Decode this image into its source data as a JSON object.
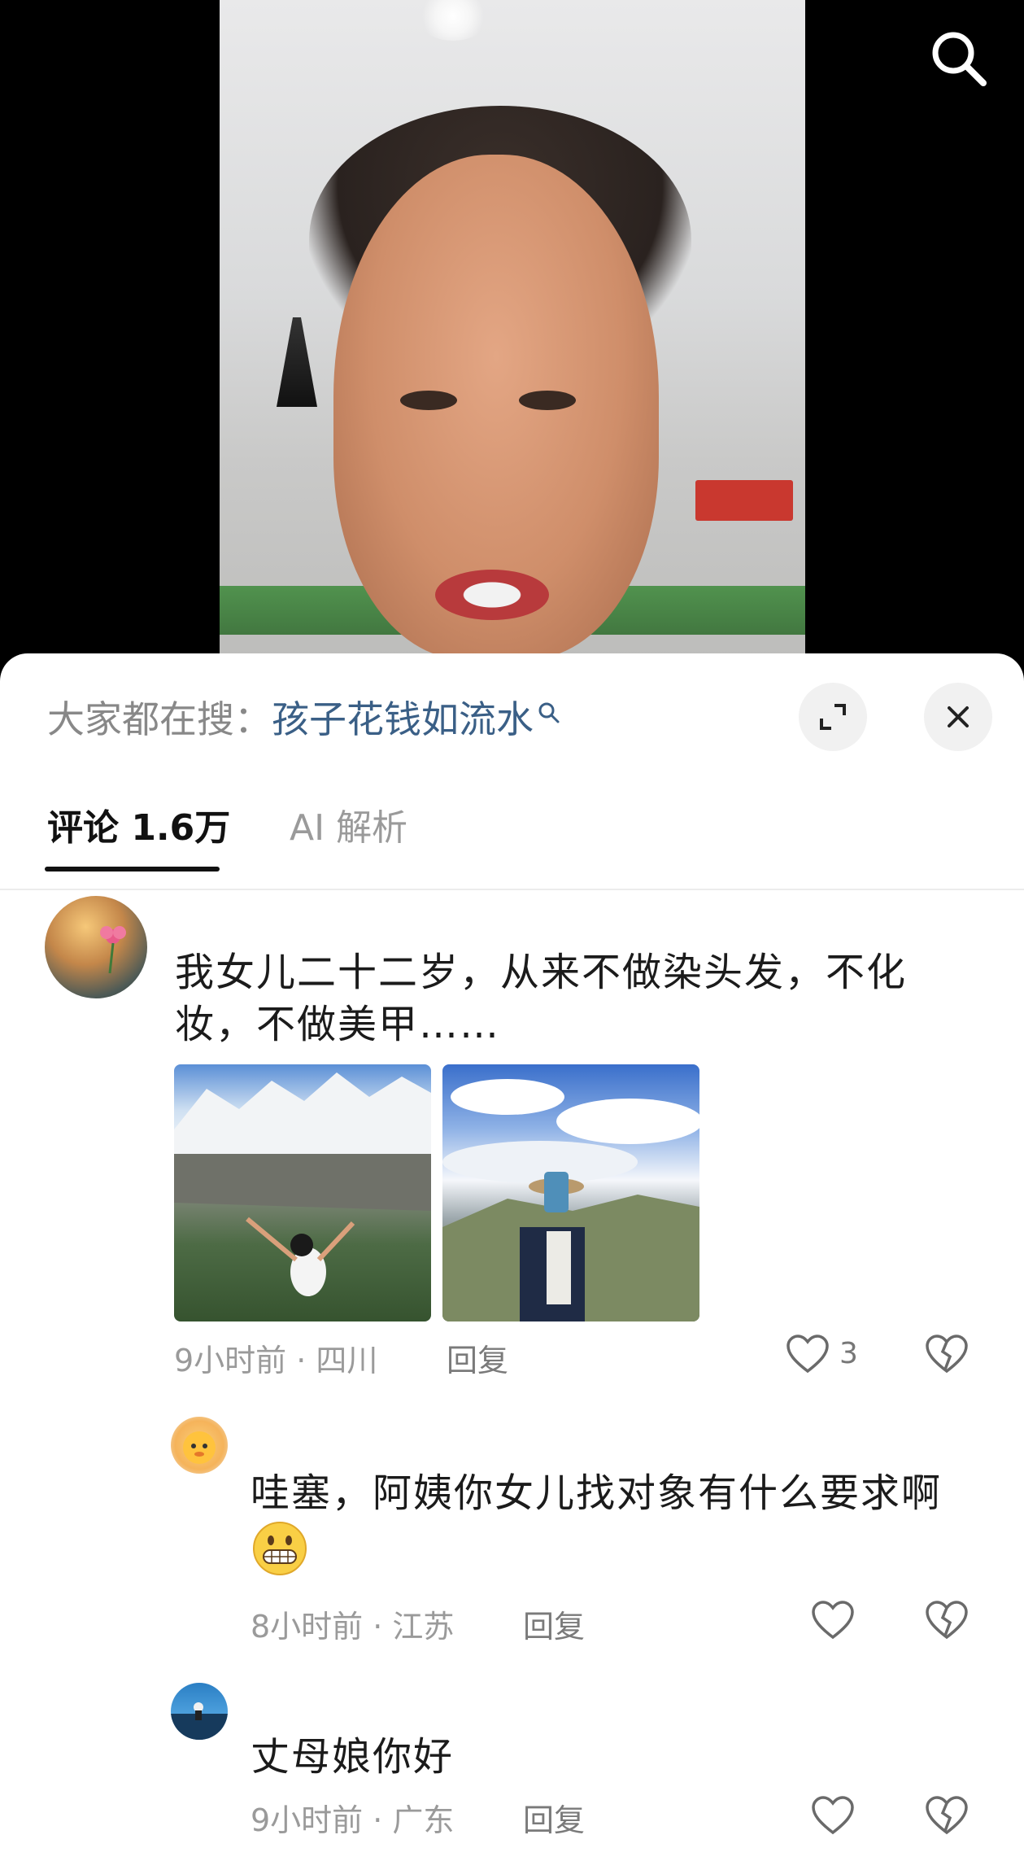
{
  "video": {},
  "hot_search": {
    "prefix": "大家都在搜：",
    "term": "孩子花钱如流水"
  },
  "tabs": [
    {
      "label": "评论 1.6万"
    },
    {
      "label": "AI 解析"
    }
  ],
  "comments": [
    {
      "text": "我女儿二十二岁，从来不做染头发，不化妆，不做美甲……",
      "meta": "9小时前 · 四川",
      "reply_label": "回复",
      "like_count": "3"
    },
    {
      "text": "哇塞，阿姨你女儿找对象有什么要求啊",
      "meta": "8小时前 · 江苏",
      "reply_label": "回复"
    },
    {
      "text": "丈母娘你好",
      "meta": "9小时前 · 广东",
      "reply_label": "回复"
    }
  ],
  "colors": {
    "hot_term": "#3a5f86",
    "tab_active": "#111111",
    "meta": "#9a9a9a"
  },
  "icons": [
    "search-icon",
    "expand-icon",
    "close-icon",
    "heart-icon",
    "broken-heart-icon",
    "grinning-emoji"
  ]
}
